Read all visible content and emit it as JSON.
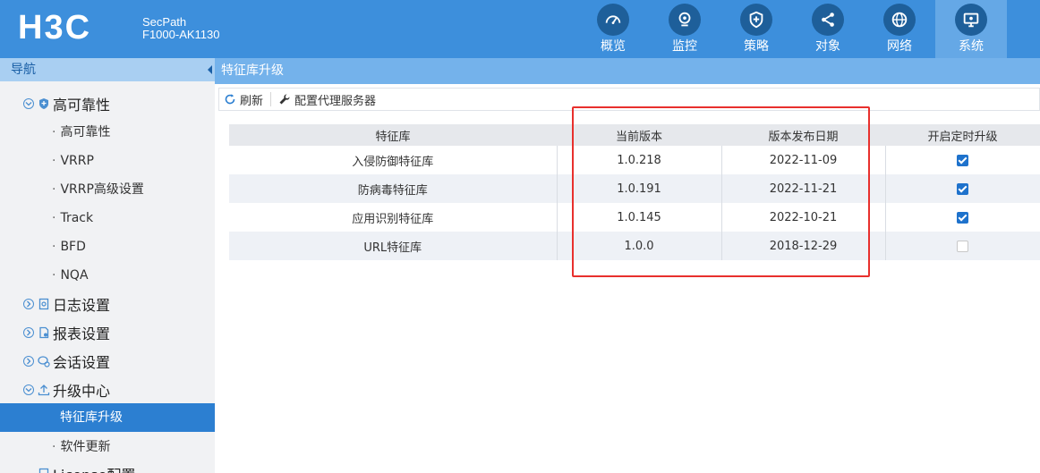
{
  "header": {
    "logo": "H3C",
    "product_line1": "SecPath",
    "product_line2": "F1000-AK1130",
    "tabs": [
      {
        "label": "概览",
        "icon": "dashboard-icon"
      },
      {
        "label": "监控",
        "icon": "camera-icon"
      },
      {
        "label": "策略",
        "icon": "shield-icon"
      },
      {
        "label": "对象",
        "icon": "share-icon"
      },
      {
        "label": "网络",
        "icon": "globe-icon"
      },
      {
        "label": "系统",
        "icon": "monitor-icon",
        "active": true
      }
    ]
  },
  "leftnav": {
    "title": "导航",
    "groups": [
      {
        "label": "高可靠性",
        "icon": "shield-icon"
      },
      {
        "label": "日志设置",
        "icon": "document-icon"
      },
      {
        "label": "报表设置",
        "icon": "report-icon"
      },
      {
        "label": "会话设置",
        "icon": "chat-icon"
      },
      {
        "label": "升级中心",
        "icon": "upload-icon"
      },
      {
        "label": "License配置",
        "icon": "license-icon"
      }
    ],
    "ha_items": [
      "高可靠性",
      "VRRP",
      "VRRP高级设置",
      "Track",
      "BFD",
      "NQA"
    ],
    "upgrade_items": [
      "特征库升级",
      "软件更新"
    ],
    "bullet": "·"
  },
  "content": {
    "title": "特征库升级",
    "toolbar": {
      "refresh": "刷新",
      "proxy": "配置代理服务器"
    },
    "columns": [
      "特征库",
      "当前版本",
      "版本发布日期",
      "开启定时升级"
    ],
    "rows": [
      {
        "name": "入侵防御特征库",
        "version": "1.0.218",
        "date": "2022-11-09",
        "auto": true
      },
      {
        "name": "防病毒特征库",
        "version": "1.0.191",
        "date": "2022-11-21",
        "auto": true
      },
      {
        "name": "应用识别特征库",
        "version": "1.0.145",
        "date": "2022-10-21",
        "auto": true
      },
      {
        "name": "URL特征库",
        "version": "1.0.0",
        "date": "2018-12-29",
        "auto": false
      }
    ]
  },
  "colors": {
    "header": "#3d8fdc",
    "accent": "#2c7fd1",
    "highlight": "#e8302d"
  }
}
